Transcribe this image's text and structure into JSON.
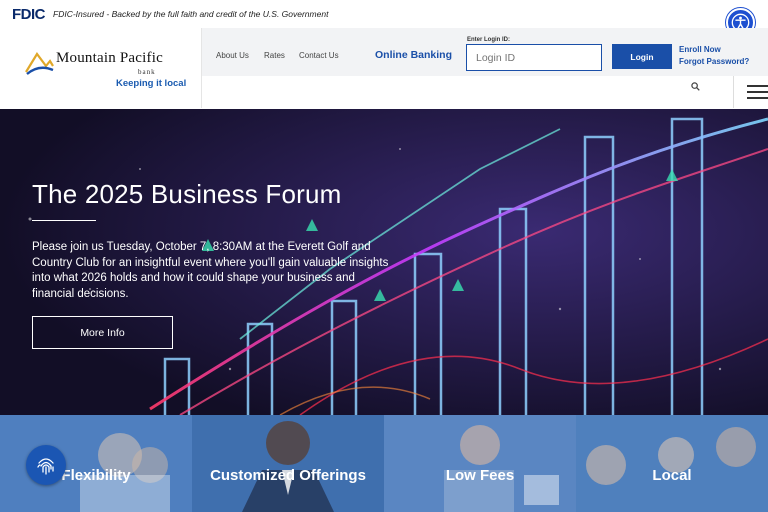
{
  "fdic": {
    "logo": "FDIC",
    "text": "FDIC-Insured - Backed by the full faith and credit of the U.S. Government"
  },
  "brand": {
    "name": "Mountain Pacific",
    "sub": "bank",
    "tagline": "Keeping it local"
  },
  "nav": {
    "about": "About Us",
    "rates": "Rates",
    "contact": "Contact Us",
    "online_banking": "Online Banking"
  },
  "login": {
    "label": "Enter Login ID:",
    "placeholder": "Login ID",
    "button": "Login",
    "enroll": "Enroll Now",
    "forgot": "Forgot Password?"
  },
  "hero": {
    "title": "The 2025 Business Forum",
    "body": "Please join us Tuesday, October 7, 8:30AM at the Everett Golf and Country Club for an insightful event where you'll gain valuable insights into what 2026 holds and how it could shape your business and financial decisions.",
    "button": "More Info"
  },
  "tiles": [
    {
      "label": "Flexibility",
      "color": "#4f7fbf"
    },
    {
      "label": "Customized Offerings",
      "color": "#3f6fae"
    },
    {
      "label": "Low Fees",
      "color": "#5a86c2"
    },
    {
      "label": "Local",
      "color": "#4f80bd"
    }
  ],
  "icons": {
    "accessibility": "accessibility-icon",
    "search": "search-icon",
    "menu": "hamburger-menu-icon",
    "fingerprint": "fingerprint-icon"
  },
  "colors": {
    "brand_blue": "#1a4fa8",
    "hero_bg": "#14102a"
  }
}
